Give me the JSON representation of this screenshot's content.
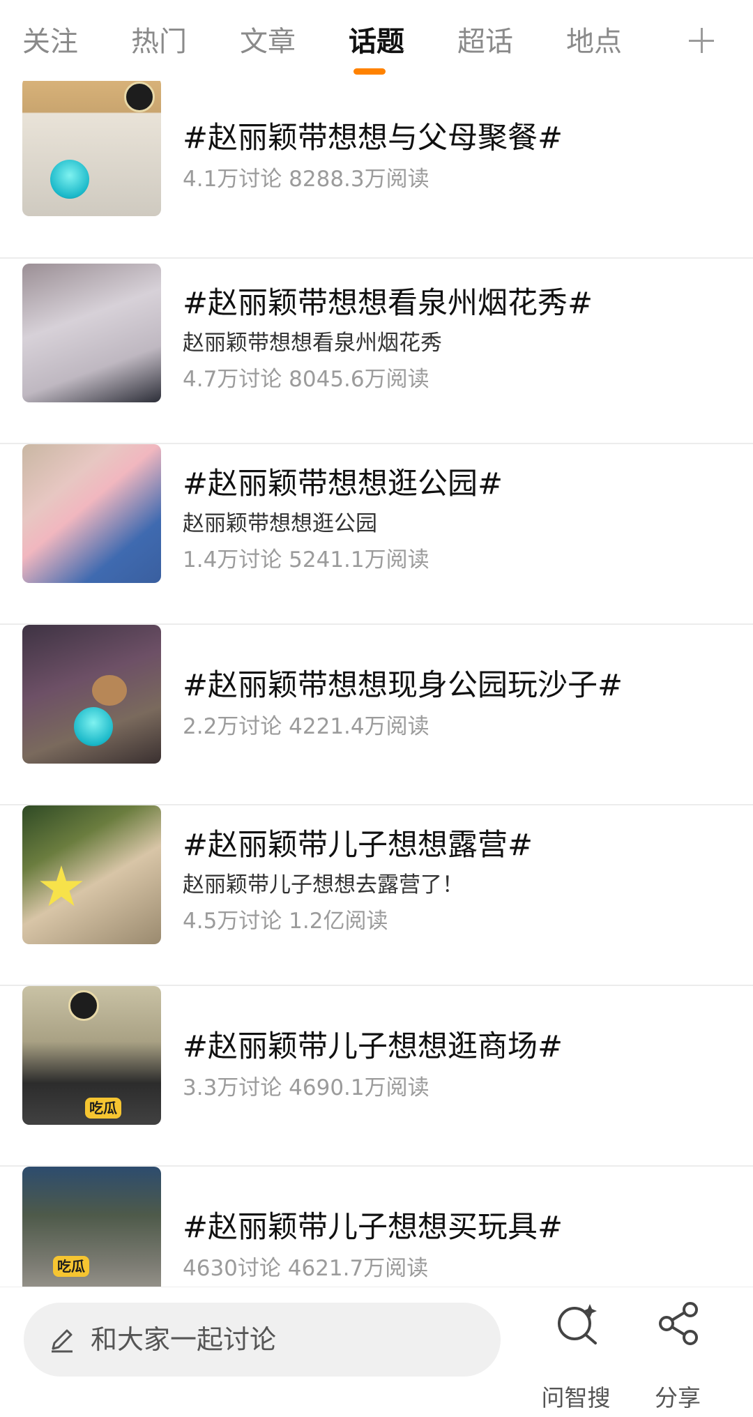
{
  "tabs": [
    {
      "label": "关注"
    },
    {
      "label": "热门"
    },
    {
      "label": "文章"
    },
    {
      "label": "话题"
    },
    {
      "label": "超话"
    },
    {
      "label": "地点"
    }
  ],
  "active_tab": "话题",
  "colors": {
    "accent": "#ff8200",
    "muted_text": "#9b9b9b",
    "separator": "#ececec"
  },
  "topics": [
    {
      "title": "#赵丽颖带想想与父母聚餐#",
      "desc": "",
      "stats": "4.1万讨论 8288.3万阅读"
    },
    {
      "title": "#赵丽颖带想想看泉州烟花秀#",
      "desc": "赵丽颖带想想看泉州烟花秀",
      "stats": "4.7万讨论 8045.6万阅读"
    },
    {
      "title": "#赵丽颖带想想逛公园#",
      "desc": "赵丽颖带想想逛公园",
      "stats": "1.4万讨论 5241.1万阅读"
    },
    {
      "title": "#赵丽颖带想想现身公园玩沙子#",
      "desc": "",
      "stats": "2.2万讨论 4221.4万阅读"
    },
    {
      "title": "#赵丽颖带儿子想想露营#",
      "desc": "赵丽颖带儿子想想去露营了！",
      "stats": "4.5万讨论 1.2亿阅读"
    },
    {
      "title": "#赵丽颖带儿子想想逛商场#",
      "desc": "",
      "stats": "3.3万讨论 4690.1万阅读"
    },
    {
      "title": "#赵丽颖带儿子想想买玩具#",
      "desc": "",
      "stats": "4630讨论 4621.7万阅读"
    }
  ],
  "bottom": {
    "compose_placeholder": "和大家一起讨论",
    "smart_search_label": "问智搜",
    "share_label": "分享"
  },
  "icons": {
    "add": "plus-icon",
    "compose": "pencil-icon",
    "smart_search": "sparkle-search-icon",
    "share": "share-icon"
  }
}
